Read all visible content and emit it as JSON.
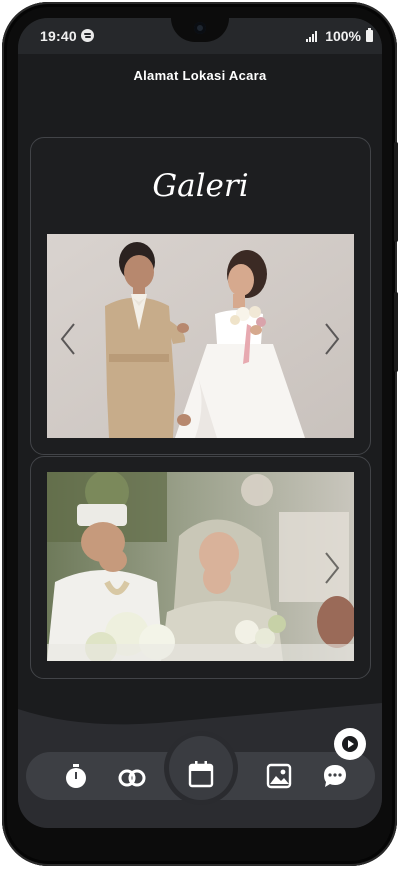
{
  "status_bar": {
    "time": "19:40",
    "battery": "100%"
  },
  "header": {
    "location_title": "Alamat Lokasi Acara"
  },
  "gallery": {
    "title": "Galeri",
    "photos": [
      {
        "label": "couple-portrait-photo"
      },
      {
        "label": "wedding-ceremony-photo"
      }
    ]
  },
  "bottom_nav": {
    "items": [
      "stopwatch-icon",
      "rings-icon",
      "calendar-icon",
      "gallery-icon",
      "chat-icon"
    ],
    "music_button": "play-music-icon"
  },
  "colors": {
    "background": "#1b1c1e",
    "card_border": "#424448",
    "nav": "#3d3f44"
  }
}
